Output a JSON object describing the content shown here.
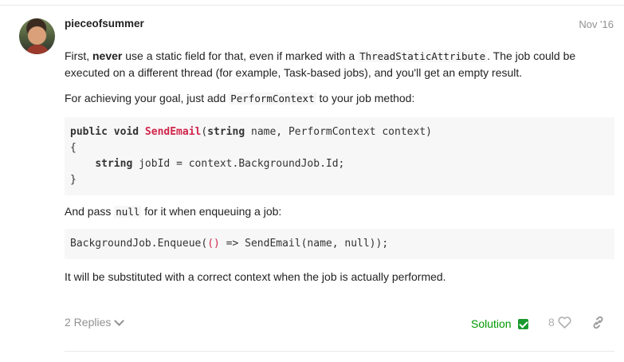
{
  "post": {
    "username": "pieceofsummer",
    "date": "Nov '16",
    "p1": {
      "a": "First, ",
      "b": "never",
      "c": " use a static field for that, even if marked with a ",
      "code": "ThreadStaticAttribute",
      "d": ". The job could be executed on a different thread (for example, Task-based jobs), and you'll get an empty result."
    },
    "p2": {
      "a": "For achieving your goal, just add ",
      "code": "PerformContext",
      "b": " to your job method:"
    },
    "code1": {
      "l1_kw": "public void ",
      "l1_fn": "SendEmail",
      "l1_paren": "(",
      "l1_kw2": "string",
      "l1_rest": " name, PerformContext context)",
      "l2": "{",
      "l3_indent": "    ",
      "l3_kw": "string",
      "l3_rest": " jobId = context.BackgroundJob.Id;",
      "l4": "}"
    },
    "p3": {
      "a": "And pass ",
      "code": "null",
      "b": " for it when enqueuing a job:"
    },
    "code2": {
      "a": "BackgroundJob.Enqueue(",
      "paren": "()",
      "b": " => SendEmail(name, null));"
    },
    "p4": "It will be substituted with a correct context when the job is actually performed."
  },
  "footer": {
    "replies": "2 Replies",
    "solution": "Solution",
    "likes": "8"
  },
  "icons": {
    "replies": "chevron-down-icon",
    "solution": "check-icon",
    "likes": "heart-icon",
    "share": "link-icon"
  },
  "colors": {
    "solution": "#009900",
    "code_highlight": "#d1254b",
    "muted": "#919191"
  }
}
